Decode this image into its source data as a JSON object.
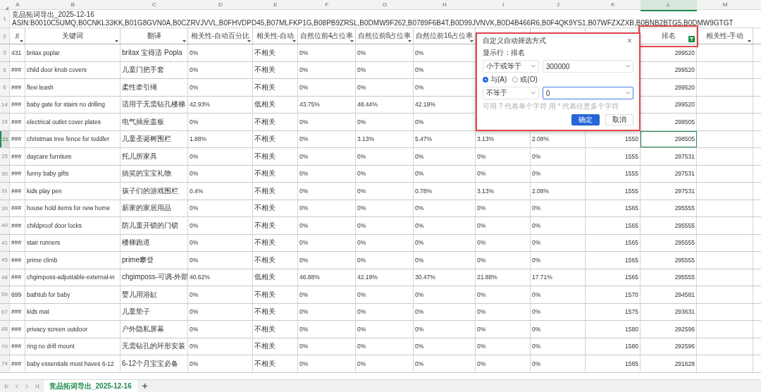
{
  "column_letters": [
    {
      "label": "A",
      "selected": false
    },
    {
      "label": "B",
      "selected": false
    },
    {
      "label": "C",
      "selected": false
    },
    {
      "label": "D",
      "selected": false
    },
    {
      "label": "E",
      "selected": false
    },
    {
      "label": "F",
      "selected": false
    },
    {
      "label": "G",
      "selected": false
    },
    {
      "label": "H",
      "selected": false
    },
    {
      "label": "I",
      "selected": false
    },
    {
      "label": "J",
      "selected": false
    },
    {
      "label": "K",
      "selected": false
    },
    {
      "label": "L",
      "selected": true
    },
    {
      "label": "M",
      "selected": false
    }
  ],
  "title_row": {
    "number": "1",
    "text": "竞品拓词导出_2025-12-16 ASIN:B0010C5UMQ,B0CNKL33KK,B01G8GVN0A,B0CZRVJVVL,B0FHVDPD45,B07MLFKP1G,B08PB9ZRSL,B0DMW9F262,B0789F6B4T,B0D99JVNVK,B0D4B466R6,B0F4QK9YS1,B07WFZXZXB,B0BNB2BTG5,B0DMW9GTGT"
  },
  "header_row": {
    "number": "2",
    "cells": [
      {
        "label": "#",
        "filtered": false
      },
      {
        "label": "关键词",
        "filtered": false
      },
      {
        "label": "翻译",
        "filtered": false
      },
      {
        "label": "相关性-自动百分比",
        "filtered": false
      },
      {
        "label": "相关性-自动",
        "filtered": false
      },
      {
        "label": "自然位前4占位率",
        "filtered": false
      },
      {
        "label": "自然位前8占位率",
        "filtered": false
      },
      {
        "label": "自然位前16占位率",
        "filtered": false
      },
      null,
      null,
      null,
      {
        "label": "排名",
        "filtered": true
      },
      {
        "label": "相关性-手动",
        "filtered": false
      }
    ]
  },
  "rows": [
    {
      "number": "3",
      "selected": false,
      "cells": [
        "431",
        "britax poplar",
        "britax 宝得适 Popla",
        "0%",
        "不相关",
        "0%",
        "0%",
        "0%",
        null,
        null,
        null,
        "299520"
      ]
    },
    {
      "number": "5",
      "selected": false,
      "cells": [
        "###",
        "child door knob covers",
        "儿童门把手套",
        "0%",
        "不相关",
        "0%",
        "0%",
        "0%",
        null,
        null,
        null,
        "299520"
      ]
    },
    {
      "number": "6",
      "selected": false,
      "cells": [
        "###",
        "flexi leash",
        "柔性牵引绳",
        "0%",
        "不相关",
        "0%",
        "0%",
        "0%",
        null,
        null,
        null,
        "299520"
      ]
    },
    {
      "number": "14",
      "selected": false,
      "cells": [
        "###",
        "baby gate for stairs no drilling",
        "适用于无需钻孔楼梯",
        "42.93%",
        "低相关",
        "43.75%",
        "48.44%",
        "42.19%",
        null,
        null,
        null,
        "299520"
      ]
    },
    {
      "number": "16",
      "selected": false,
      "cells": [
        "###",
        "electrical outlet cover plates",
        "电气插座盖板",
        "0%",
        "不相关",
        "0%",
        "0%",
        "0%",
        null,
        null,
        null,
        "298505"
      ]
    },
    {
      "number": "21",
      "selected": true,
      "cells": [
        "###",
        "christmas tree fence for toddler",
        "儿童圣诞树围栏",
        "1.88%",
        "不相关",
        "0%",
        "3.13%",
        "5.47%",
        "3.13%",
        "2.08%",
        "1550",
        "298505"
      ]
    },
    {
      "number": "25",
      "selected": false,
      "cells": [
        "###",
        "daycare furniture",
        "托儿所家具",
        "0%",
        "不相关",
        "0%",
        "0%",
        "0%",
        "0%",
        "0%",
        "1555",
        "297531"
      ]
    },
    {
      "number": "30",
      "selected": false,
      "cells": [
        "###",
        "funny baby gifts",
        "搞笑的宝宝礼物",
        "0%",
        "不相关",
        "0%",
        "0%",
        "0%",
        "0%",
        "0%",
        "1555",
        "297531"
      ]
    },
    {
      "number": "31",
      "selected": false,
      "cells": [
        "###",
        "kids play pen",
        "孩子们的游戏围栏",
        "0.4%",
        "不相关",
        "0%",
        "0%",
        "0.78%",
        "3.13%",
        "2.08%",
        "1555",
        "297531"
      ]
    },
    {
      "number": "39",
      "selected": false,
      "cells": [
        "###",
        "house hold items for new home",
        "新家的家居用品",
        "0%",
        "不相关",
        "0%",
        "0%",
        "0%",
        "0%",
        "0%",
        "1565",
        "295555"
      ]
    },
    {
      "number": "40",
      "selected": false,
      "cells": [
        "###",
        "childproof door locks",
        "防儿童开锁的门锁",
        "0%",
        "不相关",
        "0%",
        "0%",
        "0%",
        "0%",
        "0%",
        "1565",
        "295555"
      ]
    },
    {
      "number": "41",
      "selected": false,
      "cells": [
        "###",
        "stair runners",
        "楼梯跑道",
        "0%",
        "不相关",
        "0%",
        "0%",
        "0%",
        "0%",
        "0%",
        "1565",
        "295555"
      ]
    },
    {
      "number": "45",
      "selected": false,
      "cells": [
        "###",
        "prime climb",
        "prime攀登",
        "0%",
        "不相关",
        "0%",
        "0%",
        "0%",
        "0%",
        "0%",
        "1565",
        "295555"
      ]
    },
    {
      "number": "48",
      "selected": false,
      "cells": [
        "###",
        "chgimposs-adjustable-external-in",
        "chgimposs-可调-外部",
        "40.62%",
        "低相关",
        "46.88%",
        "42.19%",
        "30.47%",
        "21.88%",
        "17.71%",
        "1565",
        "295555"
      ]
    },
    {
      "number": "59",
      "selected": false,
      "cells": [
        "699",
        "bathtub for baby",
        "婴儿用浴缸",
        "0%",
        "不相关",
        "0%",
        "0%",
        "0%",
        "0%",
        "0%",
        "1570",
        "294581"
      ]
    },
    {
      "number": "67",
      "selected": false,
      "cells": [
        "###",
        "kids mat",
        "儿童垫子",
        "0%",
        "不相关",
        "0%",
        "0%",
        "0%",
        "0%",
        "0%",
        "1575",
        "293631"
      ]
    },
    {
      "number": "68",
      "selected": false,
      "cells": [
        "###",
        "privacy screen outdoor",
        "户外隐私屏幕",
        "0%",
        "不相关",
        "0%",
        "0%",
        "0%",
        "0%",
        "0%",
        "1580",
        "292596"
      ]
    },
    {
      "number": "70",
      "selected": false,
      "cells": [
        "###",
        "ring no drill mount",
        "无需钻孔的环形安装",
        "0%",
        "不相关",
        "0%",
        "0%",
        "0%",
        "0%",
        "0%",
        "1580",
        "292596"
      ]
    },
    {
      "number": "74",
      "selected": false,
      "cells": [
        "###",
        "baby essentials must haves 6-12",
        "6-12个月宝宝必备",
        "0%",
        "不相关",
        "0%",
        "0%",
        "0%",
        "0%",
        "0%",
        "1585",
        "291628"
      ]
    }
  ],
  "filter_dialog": {
    "title": "自定义自动筛选方式",
    "close": "×",
    "field_label": "显示行：排名",
    "conditions": [
      {
        "operator": "小于或等于",
        "value": "300000",
        "focused": false
      },
      {
        "operator": "不等于",
        "value": "0",
        "focused": true
      }
    ],
    "logic": [
      {
        "label": "与(A)",
        "selected": true
      },
      {
        "label": "或(O)",
        "selected": false
      }
    ],
    "hint": "可用 ? 代表单个字符 用 * 代表任意多个字符",
    "buttons": [
      {
        "label": "确定",
        "primary": true
      },
      {
        "label": "取消",
        "primary": false
      }
    ]
  },
  "sheet_tabs": [
    {
      "label": "竞品拓词导出_2025-12-16",
      "selected": true
    }
  ]
}
